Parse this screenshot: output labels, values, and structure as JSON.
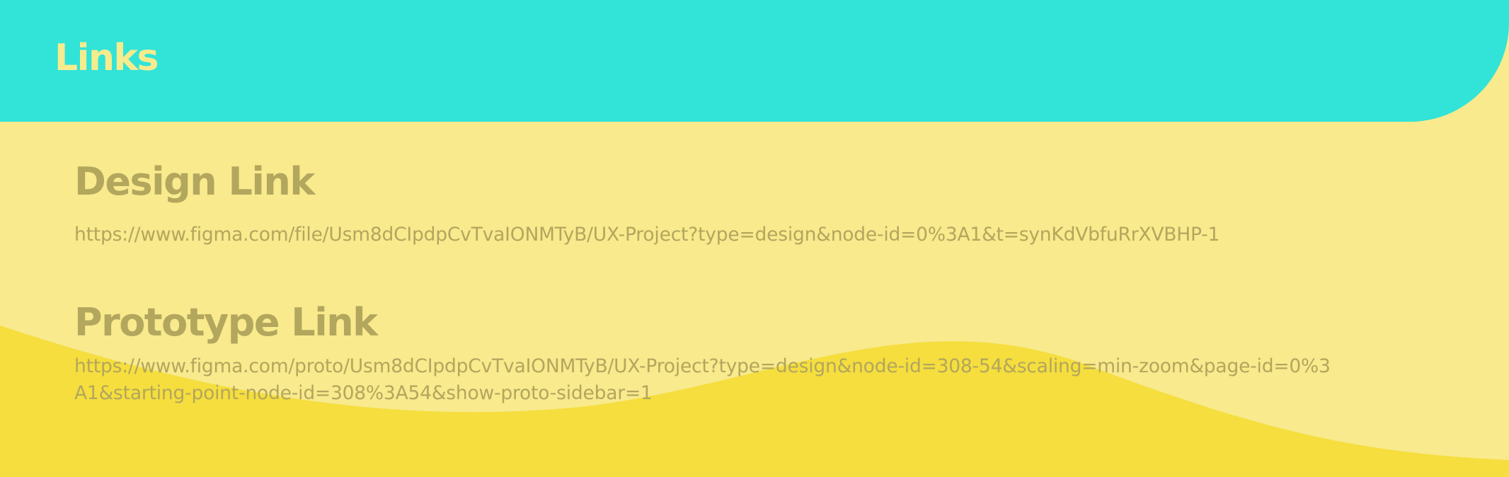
{
  "header": {
    "title": "Links"
  },
  "sections": [
    {
      "title": "Design Link",
      "url": "https://www.figma.com/file/Usm8dCIpdpCvTvaIONMTyB/UX-Project?type=design&node-id=0%3A1&t=synKdVbfuRrXVBHP-1"
    },
    {
      "title": "Prototype Link",
      "url": "https://www.figma.com/proto/Usm8dCIpdpCvTvaIONMTyB/UX-Project?type=design&node-id=308-54&scaling=min-zoom&page-id=0%3A1&starting-point-node-id=308%3A54&show-proto-sidebar=1"
    }
  ],
  "colors": {
    "header_bg": "#32e3d8",
    "page_bg": "#f8ea8d",
    "wave": "#f5de3e",
    "title_text": "#f6ec8d",
    "body_text": "#b3a65d"
  }
}
